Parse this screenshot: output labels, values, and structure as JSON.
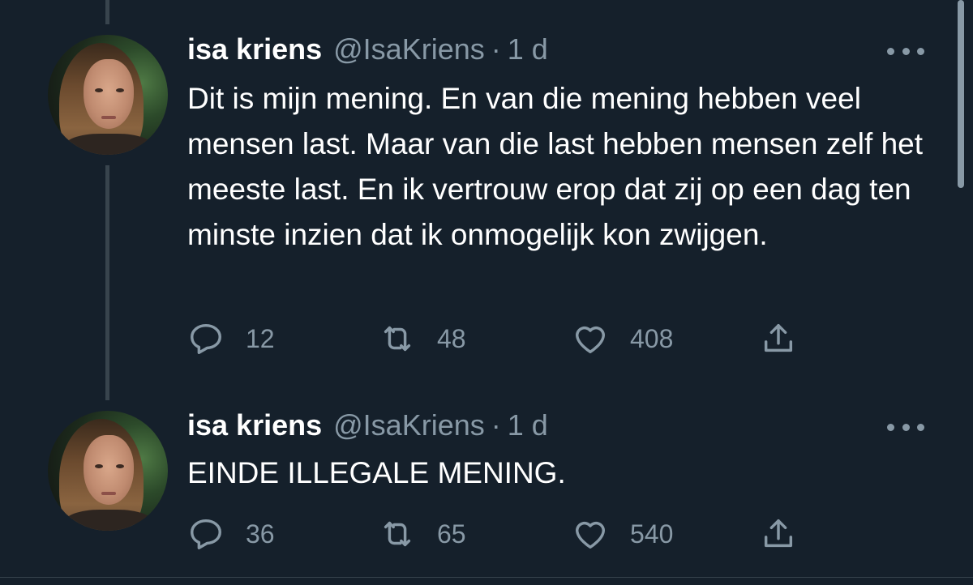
{
  "tweets": [
    {
      "author_name": "isa kriens",
      "handle": "@IsaKriens",
      "separator": "·",
      "time": "1 d",
      "text": "Dit is mijn mening. En van die mening hebben veel mensen last. Maar van die last hebben mensen zelf het meeste last. En ik vertrouw erop dat zij op een dag ten minste inzien dat ik onmogelijk kon zwijgen.",
      "replies": "12",
      "retweets": "48",
      "likes": "408"
    },
    {
      "author_name": "isa kriens",
      "handle": "@IsaKriens",
      "separator": "·",
      "time": "1 d",
      "text": "EINDE ILLEGALE MENING.",
      "replies": "36",
      "retweets": "65",
      "likes": "540"
    }
  ],
  "icons": {
    "reply": "reply-icon",
    "retweet": "retweet-icon",
    "like": "like-icon",
    "share": "share-icon",
    "more": "more-icon"
  },
  "colors": {
    "background": "#15202b",
    "text": "#ffffff",
    "secondary": "#8899a6",
    "thread_line": "#38444d"
  }
}
